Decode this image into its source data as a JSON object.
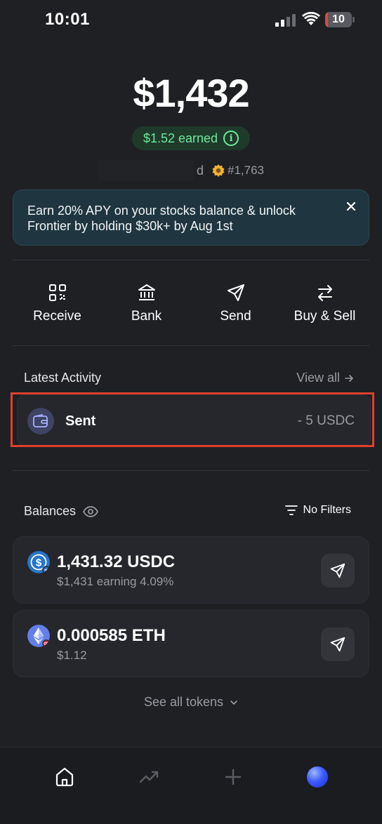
{
  "status_bar": {
    "time": "10:01",
    "battery_level": "10",
    "battery_fraction": 0.1
  },
  "header": {
    "total_balance": "$1,432",
    "earned_badge": "$1.52 earned",
    "username_suffix": "d",
    "rank": "#1,763"
  },
  "promo": {
    "text": "Earn 20% APY on your stocks balance & unlock Frontier by holding $30k+ by Aug 1st"
  },
  "actions": [
    {
      "label": "Receive",
      "icon": "qr-code-icon"
    },
    {
      "label": "Bank",
      "icon": "bank-icon"
    },
    {
      "label": "Send",
      "icon": "send-icon"
    },
    {
      "label": "Buy & Sell",
      "icon": "swap-arrows-icon"
    }
  ],
  "activity": {
    "title": "Latest Activity",
    "view_all": "View all",
    "items": [
      {
        "label": "Sent",
        "amount": "- 5 USDC",
        "icon": "wallet-icon"
      }
    ]
  },
  "balances": {
    "title": "Balances",
    "filter_label": "No Filters",
    "tokens": [
      {
        "amount": "1,431.32 USDC",
        "sub": "$1,431 earning 4.09%",
        "icon": "usdc-icon"
      },
      {
        "amount": "0.000585 ETH",
        "sub": "$1.12",
        "icon": "eth-icon"
      }
    ],
    "see_all": "See all tokens"
  },
  "bottom_nav": [
    {
      "name": "home",
      "icon": "home-icon",
      "active": true
    },
    {
      "name": "trending",
      "icon": "trending-icon",
      "active": false
    },
    {
      "name": "add",
      "icon": "plus-icon",
      "active": false
    },
    {
      "name": "profile",
      "icon": "avatar",
      "active": false
    }
  ],
  "colors": {
    "background": "#1f2024",
    "card": "#26272c",
    "earned_green": "#6ee99b",
    "highlight_red": "#e0402f",
    "secondary_text": "#9a9ba0"
  }
}
